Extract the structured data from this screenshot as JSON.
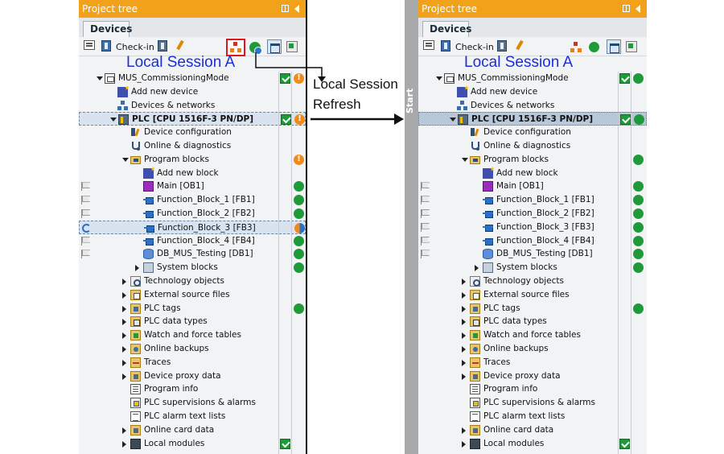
{
  "panel_header": "Project tree",
  "devices_tab": "Devices",
  "checkin_label": "Check-in",
  "session_label": "Local Session A",
  "annotation": {
    "line1": "Local Session",
    "line2": "Refresh"
  },
  "start_label": "Start",
  "colors": {
    "header": "#f2a21a",
    "session_text": "#1d2ed8",
    "highlight_box": "#e0141d",
    "ok_green": "#1f9a3a",
    "warn_orange": "#f08a1a"
  },
  "left_tree": [
    {
      "label": "MUS_CommissioningMode",
      "indent": 0,
      "expander": "open",
      "icon": "project",
      "check": true,
      "status": "warn",
      "gutter": ""
    },
    {
      "label": "Add new device",
      "indent": 1,
      "expander": "",
      "icon": "add",
      "check": false,
      "status": "",
      "gutter": ""
    },
    {
      "label": "Devices & networks",
      "indent": 1,
      "expander": "",
      "icon": "net",
      "check": false,
      "status": "",
      "gutter": ""
    },
    {
      "label": "PLC [CPU 1516F-3 PN/DP]",
      "indent": 1,
      "expander": "open",
      "icon": "plc",
      "check": true,
      "status": "warn",
      "gutter": "",
      "bold": true,
      "rowstyle": "sel"
    },
    {
      "label": "Device configuration",
      "indent": 2,
      "expander": "",
      "icon": "devcfg",
      "check": false,
      "status": "",
      "gutter": ""
    },
    {
      "label": "Online & diagnostics",
      "indent": 2,
      "expander": "",
      "icon": "diag",
      "check": false,
      "status": "",
      "gutter": ""
    },
    {
      "label": "Program blocks",
      "indent": 2,
      "expander": "open",
      "icon": "folder",
      "check": false,
      "status": "warn",
      "gutter": ""
    },
    {
      "label": "Add new block",
      "indent": 3,
      "expander": "",
      "icon": "add",
      "check": false,
      "status": "",
      "gutter": ""
    },
    {
      "label": "Main [OB1]",
      "indent": 3,
      "expander": "",
      "icon": "ob",
      "check": false,
      "status": "ok",
      "gutter": "flag"
    },
    {
      "label": "Function_Block_1 [FB1]",
      "indent": 3,
      "expander": "",
      "icon": "fb",
      "check": false,
      "status": "ok",
      "gutter": "flag"
    },
    {
      "label": "Function_Block_2 [FB2]",
      "indent": 3,
      "expander": "",
      "icon": "fb",
      "check": false,
      "status": "ok",
      "gutter": "flag"
    },
    {
      "label": "Function_Block_3 [FB3]",
      "indent": 3,
      "expander": "",
      "icon": "fb",
      "check": false,
      "status": "split",
      "gutter": "sync",
      "rowstyle": "sel"
    },
    {
      "label": "Function_Block_4 [FB4]",
      "indent": 3,
      "expander": "",
      "icon": "fb",
      "check": false,
      "status": "ok",
      "gutter": "flag"
    },
    {
      "label": "DB_MUS_Testing [DB1]",
      "indent": 3,
      "expander": "",
      "icon": "db",
      "check": false,
      "status": "ok",
      "gutter": "flag"
    },
    {
      "label": "System blocks",
      "indent": 3,
      "expander": "closed",
      "icon": "sys",
      "check": false,
      "status": "ok",
      "gutter": ""
    },
    {
      "label": "Technology objects",
      "indent": 2,
      "expander": "closed",
      "icon": "tech",
      "check": false,
      "status": "",
      "gutter": ""
    },
    {
      "label": "External source files",
      "indent": 2,
      "expander": "closed",
      "icon": "ext",
      "check": false,
      "status": "",
      "gutter": ""
    },
    {
      "label": "PLC tags",
      "indent": 2,
      "expander": "closed",
      "icon": "tags",
      "check": false,
      "status": "ok",
      "gutter": ""
    },
    {
      "label": "PLC data types",
      "indent": 2,
      "expander": "closed",
      "icon": "types",
      "check": false,
      "status": "",
      "gutter": ""
    },
    {
      "label": "Watch and force tables",
      "indent": 2,
      "expander": "closed",
      "icon": "watch",
      "check": false,
      "status": "",
      "gutter": ""
    },
    {
      "label": "Online backups",
      "indent": 2,
      "expander": "closed",
      "icon": "backup",
      "check": false,
      "status": "",
      "gutter": ""
    },
    {
      "label": "Traces",
      "indent": 2,
      "expander": "closed",
      "icon": "traces",
      "check": false,
      "status": "",
      "gutter": ""
    },
    {
      "label": "Device proxy data",
      "indent": 2,
      "expander": "closed",
      "icon": "proxy",
      "check": false,
      "status": "",
      "gutter": ""
    },
    {
      "label": "Program info",
      "indent": 2,
      "expander": "",
      "icon": "info",
      "check": false,
      "status": "",
      "gutter": ""
    },
    {
      "label": "PLC supervisions & alarms",
      "indent": 2,
      "expander": "",
      "icon": "alarm",
      "check": false,
      "status": "",
      "gutter": ""
    },
    {
      "label": "PLC alarm text lists",
      "indent": 2,
      "expander": "",
      "icon": "alarmtext",
      "check": false,
      "status": "",
      "gutter": ""
    },
    {
      "label": "Online card data",
      "indent": 2,
      "expander": "closed",
      "icon": "card",
      "check": false,
      "status": "",
      "gutter": ""
    },
    {
      "label": "Local modules",
      "indent": 2,
      "expander": "closed",
      "icon": "local",
      "check": true,
      "status": "",
      "gutter": ""
    }
  ],
  "right_tree": [
    {
      "label": "MUS_CommissioningMode",
      "indent": 0,
      "expander": "open",
      "icon": "project",
      "check": true,
      "status": "ok",
      "gutter": ""
    },
    {
      "label": "Add new device",
      "indent": 1,
      "expander": "",
      "icon": "add",
      "check": false,
      "status": "",
      "gutter": ""
    },
    {
      "label": "Devices & networks",
      "indent": 1,
      "expander": "",
      "icon": "net",
      "check": false,
      "status": "",
      "gutter": ""
    },
    {
      "label": "PLC [CPU 1516F-3 PN/DP]",
      "indent": 1,
      "expander": "open",
      "icon": "plc",
      "check": true,
      "status": "ok",
      "gutter": "",
      "bold": true,
      "rowstyle": "hl"
    },
    {
      "label": "Device configuration",
      "indent": 2,
      "expander": "",
      "icon": "devcfg",
      "check": false,
      "status": "",
      "gutter": ""
    },
    {
      "label": "Online & diagnostics",
      "indent": 2,
      "expander": "",
      "icon": "diag",
      "check": false,
      "status": "",
      "gutter": ""
    },
    {
      "label": "Program blocks",
      "indent": 2,
      "expander": "open",
      "icon": "folder",
      "check": false,
      "status": "ok",
      "gutter": ""
    },
    {
      "label": "Add new block",
      "indent": 3,
      "expander": "",
      "icon": "add",
      "check": false,
      "status": "",
      "gutter": ""
    },
    {
      "label": "Main [OB1]",
      "indent": 3,
      "expander": "",
      "icon": "ob",
      "check": false,
      "status": "ok",
      "gutter": "flag"
    },
    {
      "label": "Function_Block_1 [FB1]",
      "indent": 3,
      "expander": "",
      "icon": "fb",
      "check": false,
      "status": "ok",
      "gutter": "flag"
    },
    {
      "label": "Function_Block_2 [FB2]",
      "indent": 3,
      "expander": "",
      "icon": "fb",
      "check": false,
      "status": "ok",
      "gutter": "flag"
    },
    {
      "label": "Function_Block_3 [FB3]",
      "indent": 3,
      "expander": "",
      "icon": "fb",
      "check": false,
      "status": "ok",
      "gutter": "flag"
    },
    {
      "label": "Function_Block_4 [FB4]",
      "indent": 3,
      "expander": "",
      "icon": "fb",
      "check": false,
      "status": "ok",
      "gutter": "flag"
    },
    {
      "label": "DB_MUS_Testing [DB1]",
      "indent": 3,
      "expander": "",
      "icon": "db",
      "check": false,
      "status": "ok",
      "gutter": "flag"
    },
    {
      "label": "System blocks",
      "indent": 3,
      "expander": "closed",
      "icon": "sys",
      "check": false,
      "status": "ok",
      "gutter": ""
    },
    {
      "label": "Technology objects",
      "indent": 2,
      "expander": "closed",
      "icon": "tech",
      "check": false,
      "status": "",
      "gutter": ""
    },
    {
      "label": "External source files",
      "indent": 2,
      "expander": "closed",
      "icon": "ext",
      "check": false,
      "status": "",
      "gutter": ""
    },
    {
      "label": "PLC tags",
      "indent": 2,
      "expander": "closed",
      "icon": "tags",
      "check": false,
      "status": "ok",
      "gutter": ""
    },
    {
      "label": "PLC data types",
      "indent": 2,
      "expander": "closed",
      "icon": "types",
      "check": false,
      "status": "",
      "gutter": ""
    },
    {
      "label": "Watch and force tables",
      "indent": 2,
      "expander": "closed",
      "icon": "watch",
      "check": false,
      "status": "",
      "gutter": ""
    },
    {
      "label": "Online backups",
      "indent": 2,
      "expander": "closed",
      "icon": "backup",
      "check": false,
      "status": "",
      "gutter": ""
    },
    {
      "label": "Traces",
      "indent": 2,
      "expander": "closed",
      "icon": "traces",
      "check": false,
      "status": "",
      "gutter": ""
    },
    {
      "label": "Device proxy data",
      "indent": 2,
      "expander": "closed",
      "icon": "proxy",
      "check": false,
      "status": "",
      "gutter": ""
    },
    {
      "label": "Program info",
      "indent": 2,
      "expander": "",
      "icon": "info",
      "check": false,
      "status": "",
      "gutter": ""
    },
    {
      "label": "PLC supervisions & alarms",
      "indent": 2,
      "expander": "",
      "icon": "alarm",
      "check": false,
      "status": "",
      "gutter": ""
    },
    {
      "label": "PLC alarm text lists",
      "indent": 2,
      "expander": "",
      "icon": "alarmtext",
      "check": false,
      "status": "",
      "gutter": ""
    },
    {
      "label": "Online card data",
      "indent": 2,
      "expander": "closed",
      "icon": "card",
      "check": false,
      "status": "",
      "gutter": ""
    },
    {
      "label": "Local modules",
      "indent": 2,
      "expander": "closed",
      "icon": "local",
      "check": true,
      "status": "",
      "gutter": ""
    }
  ]
}
